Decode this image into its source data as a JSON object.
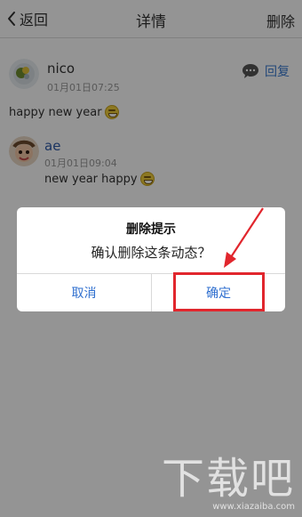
{
  "header": {
    "back_label": "返回",
    "title": "详情",
    "delete_label": "删除"
  },
  "post": {
    "author": "nico",
    "time": "01月01日07:25",
    "text": "happy new year",
    "reply_label": "回复"
  },
  "comment": {
    "author": "ae",
    "time": "01月01日09:04",
    "text": "new year happy"
  },
  "dialog": {
    "title": "删除提示",
    "message": "确认删除这条动态？",
    "cancel_label": "取消",
    "confirm_label": "确定"
  },
  "watermark": {
    "main": "下载吧",
    "url": "www.xiazaiba.com"
  },
  "colors": {
    "accent": "#2f6fcf",
    "link": "#3b7bd1",
    "annotation": "#e1262d"
  }
}
